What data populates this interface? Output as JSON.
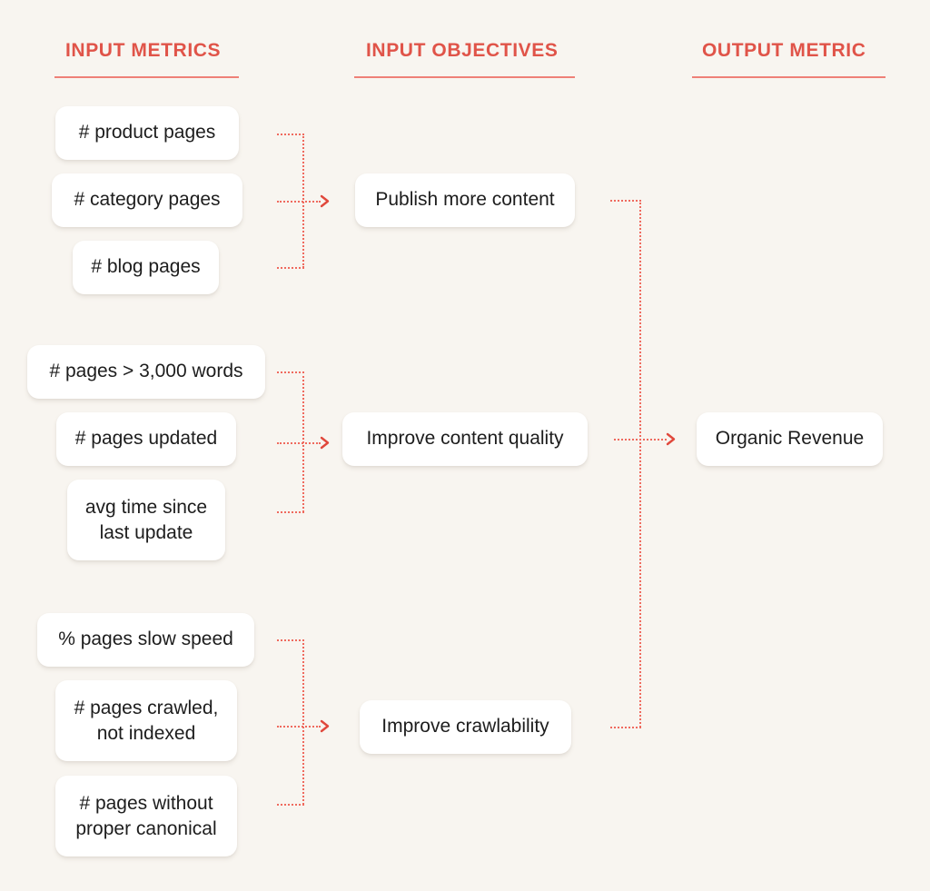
{
  "diagram": {
    "title": "SEO input metrics to output metric flow",
    "background_color": "#f8f5f0",
    "accent_color": "#e05449",
    "connector_color": "#ef6a5e",
    "node_color": "#ffffff"
  },
  "columns": [
    {
      "id": "input-metrics",
      "label": "INPUT METRICS"
    },
    {
      "id": "input-objectives",
      "label": "INPUT OBJECTIVES"
    },
    {
      "id": "output-metric",
      "label": "OUTPUT METRIC"
    }
  ],
  "input_metrics": {
    "groups": [
      {
        "id": "publish-group",
        "items": [
          {
            "label": "# product pages"
          },
          {
            "label": "# category pages"
          },
          {
            "label": "# blog pages"
          }
        ]
      },
      {
        "id": "quality-group",
        "items": [
          {
            "label": "# pages > 3,000 words"
          },
          {
            "label": "# pages updated"
          },
          {
            "line1": "avg time since",
            "line2": "last update"
          }
        ]
      },
      {
        "id": "crawl-group",
        "items": [
          {
            "label": "% pages slow speed"
          },
          {
            "line1": "# pages crawled,",
            "line2": "not indexed"
          },
          {
            "line1": "# pages without",
            "line2": "proper canonical"
          }
        ]
      }
    ]
  },
  "input_objectives": {
    "items": [
      {
        "label": "Publish more content"
      },
      {
        "label": "Improve content quality"
      },
      {
        "label": "Improve crawlability"
      }
    ]
  },
  "output_metric": {
    "items": [
      {
        "label": "Organic Revenue"
      }
    ]
  }
}
